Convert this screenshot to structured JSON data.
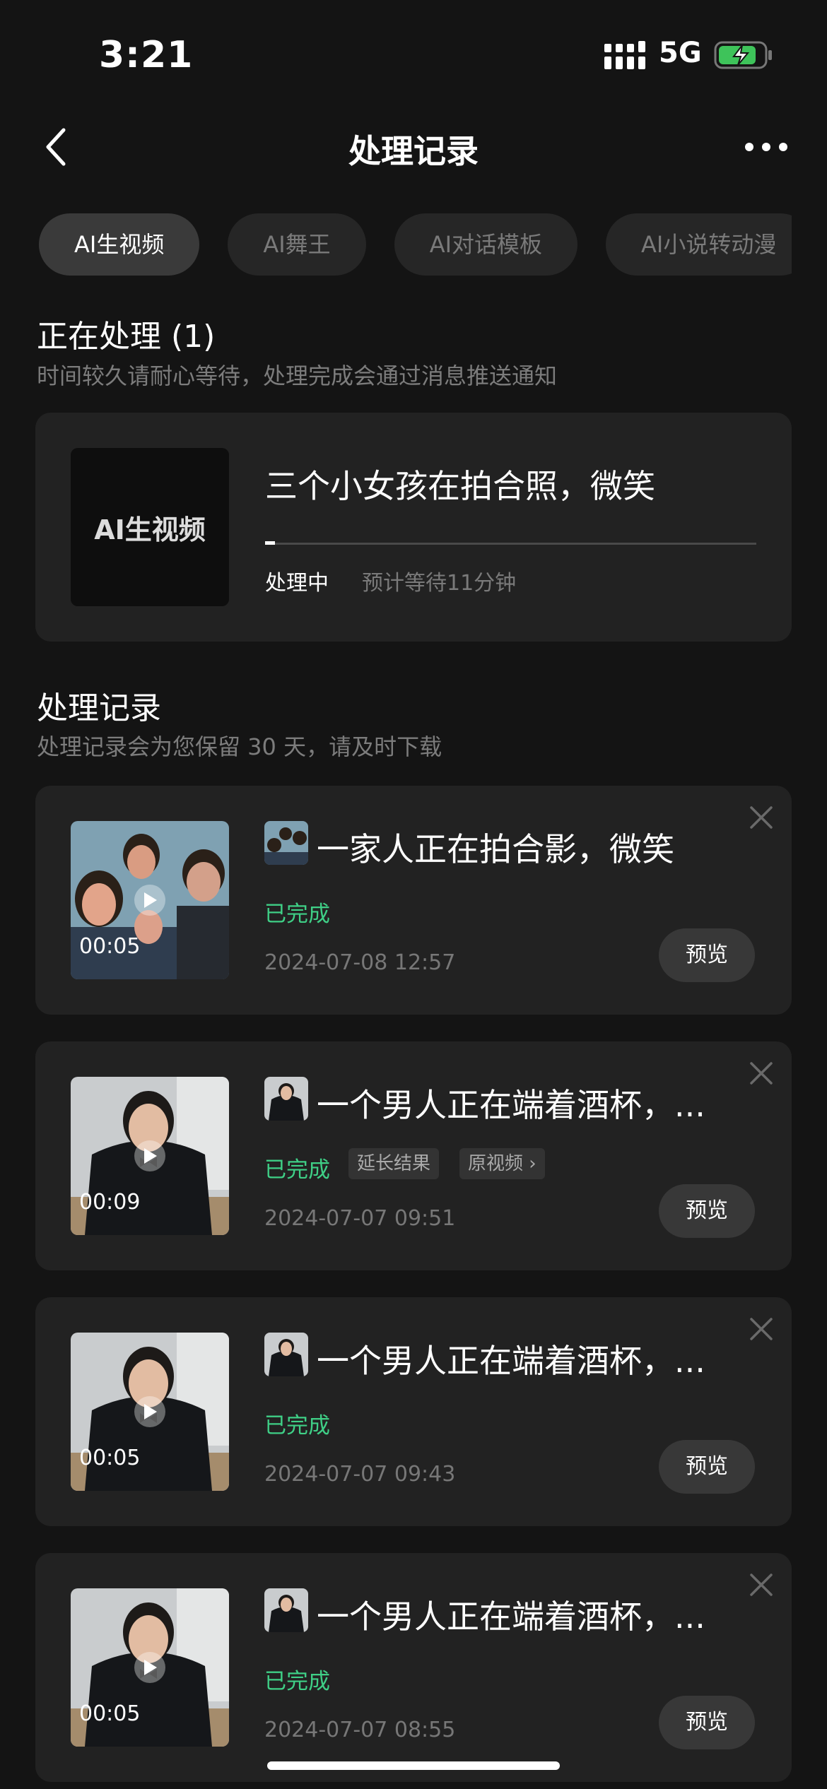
{
  "status_bar": {
    "time": "3:21",
    "network": "5G"
  },
  "nav": {
    "title": "处理记录"
  },
  "tabs": [
    "AI生视频",
    "AI舞王",
    "AI对话模板",
    "AI小说转动漫"
  ],
  "processing": {
    "heading": "正在处理 (1)",
    "subtitle": "时间较久请耐心等待，处理完成会通过消息推送通知",
    "thumb_label": "AI生视频",
    "title": "三个小女孩在拍合照，微笑",
    "status": "处理中",
    "eta": "预计等待11分钟",
    "progress": 0.02
  },
  "records": {
    "heading": "处理记录",
    "subtitle": "处理记录会为您保留 30 天，请及时下载",
    "preview_label": "预览",
    "items": [
      {
        "title": "一家人正在拍合影，微笑",
        "status": "已完成",
        "date": "2024-07-08 12:57",
        "duration": "00:05",
        "tags": []
      },
      {
        "title": "一个男人正在端着酒杯，...",
        "status": "已完成",
        "date": "2024-07-07 09:51",
        "duration": "00:09",
        "tags": [
          "延长结果",
          "原视频 ›"
        ]
      },
      {
        "title": "一个男人正在端着酒杯，...",
        "status": "已完成",
        "date": "2024-07-07 09:43",
        "duration": "00:05",
        "tags": []
      },
      {
        "title": "一个男人正在端着酒杯，...",
        "status": "已完成",
        "date": "2024-07-07 08:55",
        "duration": "00:05",
        "tags": []
      }
    ]
  },
  "colors": {
    "accent_green": "#3fcf86",
    "background": "#141414",
    "card": "#222222"
  }
}
